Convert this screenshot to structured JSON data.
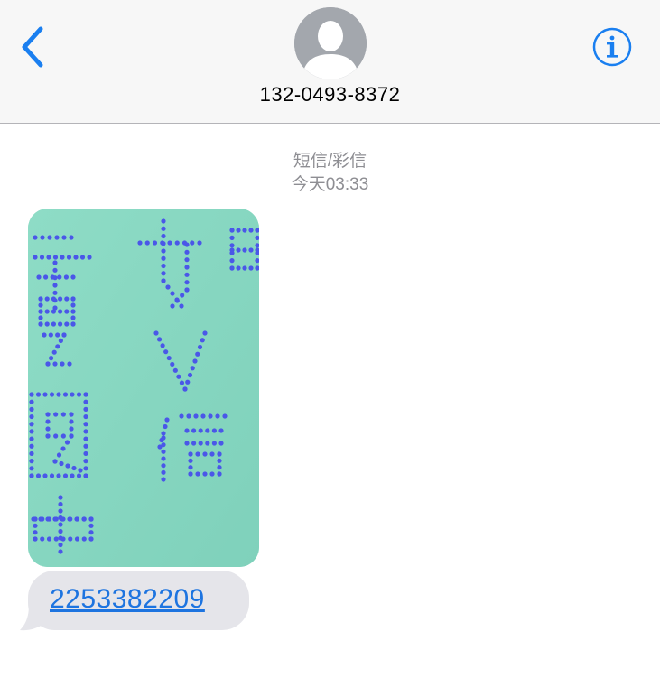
{
  "header": {
    "back_icon": "chevron-left-icon",
    "avatar_icon": "person-silhouette-icon",
    "contact": "132-0493-8372",
    "info_icon": "info-circle-icon",
    "accent_color": "#1a7ff0"
  },
  "conversation": {
    "service_label": "短信/彩信",
    "timestamp": "今天03:33",
    "messages": [
      {
        "kind": "image",
        "description_icon": "mms-photo",
        "background_color": "#86d7c0",
        "dot_color": "#4a57e8"
      },
      {
        "kind": "text",
        "text": "2253382209",
        "link_color": "#1d74e0",
        "bubble_color": "#e5e5ea"
      }
    ]
  }
}
